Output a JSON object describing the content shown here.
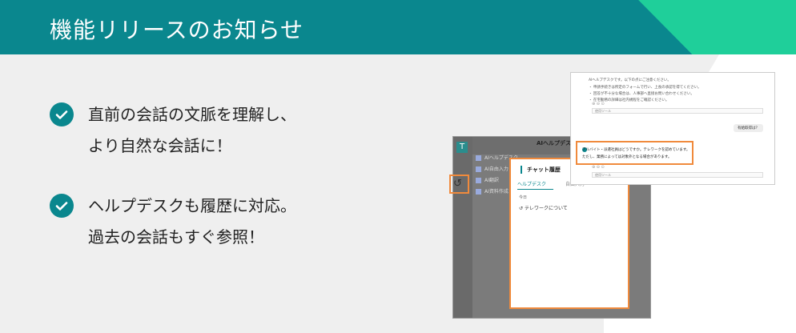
{
  "header": {
    "title": "機能リリースのお知らせ"
  },
  "features": [
    {
      "line1": "直前の会話の文脈を理解し、",
      "line2": "より自然な会話に！"
    },
    {
      "line1": "ヘルプデスクも履歴に対応。",
      "line2": "過去の会話もすぐ参照！"
    }
  ],
  "screenshot": {
    "app": {
      "logo": "T",
      "chat_header": "AIヘルプデスク",
      "nav": [
        "AIヘルプデスク",
        "AI自由入力",
        "AI翻訳",
        "AI資料作成"
      ],
      "history_icon": "↺"
    },
    "panel": {
      "title": "チャット履歴",
      "tab_active": "ヘルプデスク",
      "tab_other": "自由入力",
      "group_label": "今日",
      "history_item": "テレワークについて"
    },
    "doc": {
      "lines": [
        "AIヘルプデスクです。以下の点にご注意ください。",
        "・ 申請手続きは所定のフォームで行い、上長の承認を得てください。",
        "・ 回答が不十分な場合は、人事部へ直接お問い合わせください。",
        "・ 在宅勤務の詳細は社内規程をご確認ください。"
      ],
      "select_label": "使用ツール",
      "bubble": "有給取得は？",
      "q_line1": "アルバイト・派遣社員はどうですか。テレワークを認めています。",
      "q_line2": "ただし、業務によっては対象外となる場合があります。"
    }
  },
  "colors": {
    "teal": "#0a878e",
    "green": "#1fcf9a",
    "highlight": "#f08a3c"
  }
}
